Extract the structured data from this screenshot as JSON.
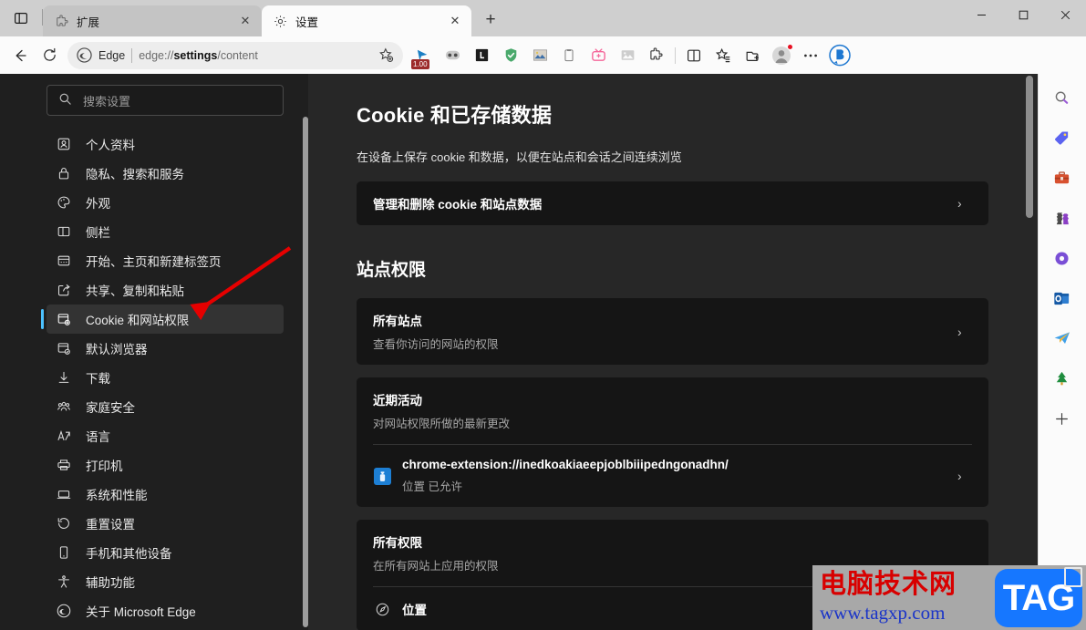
{
  "window": {
    "minimize_label": "最小化",
    "maximize_label": "最大化",
    "close_label": "关闭"
  },
  "tabstrip": {
    "tab_search_name": "tab-search",
    "new_tab_label": "+",
    "tabs": [
      {
        "title": "扩展",
        "icon": "puzzle-icon",
        "active": false,
        "close_label": "✕"
      },
      {
        "title": "设置",
        "icon": "gear-icon",
        "active": true,
        "close_label": "✕"
      }
    ]
  },
  "toolbar": {
    "back_label": "←",
    "refresh_label": "⟳",
    "omnibox": {
      "brand": "Edge",
      "url_prefix": "edge://",
      "url_bold": "settings",
      "url_suffix": "/content",
      "favorite_label": "添加到收藏夹"
    },
    "extensions": [
      {
        "name": "tampermonkey-icon",
        "badge": "1.00"
      },
      {
        "name": "split-screen-extension-icon",
        "badge": ""
      },
      {
        "name": "lastpass-icon",
        "badge": ""
      },
      {
        "name": "adguard-shield-icon",
        "badge": ""
      },
      {
        "name": "image-downloader-icon",
        "badge": ""
      },
      {
        "name": "clipboard-icon",
        "badge": ""
      },
      {
        "name": "tv-pink-icon",
        "badge": ""
      },
      {
        "name": "picture-icon",
        "badge": ""
      },
      {
        "name": "puzzle-extensions-icon",
        "badge": ""
      }
    ],
    "actions": [
      {
        "name": "split-screen-icon"
      },
      {
        "name": "favorites-icon"
      },
      {
        "name": "collections-icon"
      },
      {
        "name": "profile-icon"
      },
      {
        "name": "settings-more-icon"
      },
      {
        "name": "copilot-icon"
      }
    ]
  },
  "settings_nav": {
    "search_placeholder": "搜索设置",
    "search_value": "",
    "items": [
      {
        "label": "个人资料",
        "icon": "profile-icon",
        "selected": false
      },
      {
        "label": "隐私、搜索和服务",
        "icon": "lock-icon",
        "selected": false
      },
      {
        "label": "外观",
        "icon": "palette-icon",
        "selected": false
      },
      {
        "label": "侧栏",
        "icon": "sidebar-icon",
        "selected": false
      },
      {
        "label": "开始、主页和新建标签页",
        "icon": "startpage-icon",
        "selected": false
      },
      {
        "label": "共享、复制和粘贴",
        "icon": "share-icon",
        "selected": false
      },
      {
        "label": "Cookie 和网站权限",
        "icon": "cookie-permissions-icon",
        "selected": true
      },
      {
        "label": "默认浏览器",
        "icon": "default-browser-icon",
        "selected": false
      },
      {
        "label": "下载",
        "icon": "download-icon",
        "selected": false
      },
      {
        "label": "家庭安全",
        "icon": "family-icon",
        "selected": false
      },
      {
        "label": "语言",
        "icon": "language-icon",
        "selected": false
      },
      {
        "label": "打印机",
        "icon": "printer-icon",
        "selected": false
      },
      {
        "label": "系统和性能",
        "icon": "system-icon",
        "selected": false
      },
      {
        "label": "重置设置",
        "icon": "reset-icon",
        "selected": false
      },
      {
        "label": "手机和其他设备",
        "icon": "phone-icon",
        "selected": false
      },
      {
        "label": "辅助功能",
        "icon": "accessibility-icon",
        "selected": false
      },
      {
        "label": "关于 Microsoft Edge",
        "icon": "edge-icon",
        "selected": false
      }
    ]
  },
  "main": {
    "cookies_section": {
      "heading": "Cookie 和已存储数据",
      "description": "在设备上保存 cookie 和数据，以便在站点和会话之间连续浏览",
      "manage_row": {
        "title": "管理和删除 cookie 和站点数据",
        "chevron": "›"
      }
    },
    "permissions_section": {
      "heading": "站点权限",
      "all_sites": {
        "title": "所有站点",
        "subtitle": "查看你访问的网站的权限",
        "chevron": "›"
      },
      "recent_activity": {
        "title": "近期活动",
        "subtitle": "对网站权限所做的最新更改",
        "entry": {
          "url": "chrome-extension://inedkoakiaeepjoblbiiipedngonadhn/",
          "status": "位置 已允许",
          "icon": "extension-site-icon",
          "chevron": "›"
        }
      },
      "all_permissions": {
        "title": "所有权限",
        "subtitle": "在所有网站上应用的权限",
        "first_permission": "位置"
      }
    }
  },
  "rightbar": {
    "items": [
      {
        "name": "sidebar-search-icon",
        "glyph": "🔍"
      },
      {
        "name": "sidebar-shopping-icon",
        "glyph": "🏷"
      },
      {
        "name": "sidebar-tools-icon",
        "glyph": "🧰"
      },
      {
        "name": "sidebar-games-icon",
        "glyph": "♟"
      },
      {
        "name": "sidebar-office-icon",
        "glyph": "◍"
      },
      {
        "name": "sidebar-outlook-icon",
        "glyph": "📧"
      },
      {
        "name": "sidebar-telegram-icon",
        "glyph": "✈"
      },
      {
        "name": "sidebar-tree-icon",
        "glyph": "🌲"
      },
      {
        "name": "sidebar-add-icon",
        "glyph": "＋"
      }
    ]
  },
  "watermark": {
    "chinese": "电脑技术网",
    "url": "www.tagxp.com",
    "badge": "TAG"
  },
  "colors": {
    "accent": "#4cc2ff",
    "page_bg": "#272727",
    "card_bg": "#151515",
    "nav_bg": "#1f1f1f",
    "annotation_red": "#e60000"
  }
}
